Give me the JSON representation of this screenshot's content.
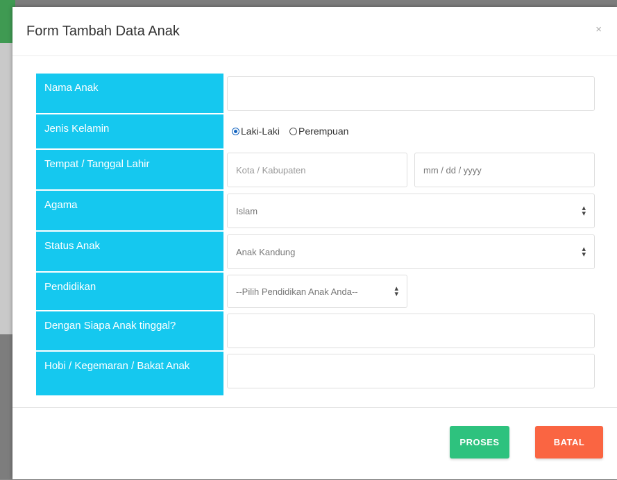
{
  "modal": {
    "title": "Form Tambah Data Anak",
    "close_symbol": "×"
  },
  "form": {
    "nama_anak": {
      "label": "Nama Anak",
      "value": ""
    },
    "jenis_kelamin": {
      "label": "Jenis Kelamin",
      "options": [
        "Laki-Laki",
        "Perempuan"
      ],
      "selected": "Laki-Laki"
    },
    "tempat_tanggal_lahir": {
      "label": "Tempat / Tanggal Lahir",
      "tempat_placeholder": "Kota / Kabupaten",
      "tanggal_placeholder": "mm / dd / yyyy"
    },
    "agama": {
      "label": "Agama",
      "selected": "Islam"
    },
    "status_anak": {
      "label": "Status Anak",
      "selected": "Anak Kandung"
    },
    "pendidikan": {
      "label": "Pendidikan",
      "selected": "--Pilih Pendidikan Anak Anda--"
    },
    "tinggal_dengan": {
      "label": "Dengan Siapa Anak tinggal?",
      "value": ""
    },
    "hobi": {
      "label": "Hobi / Kegemaran / Bakat Anak",
      "value": ""
    }
  },
  "footer": {
    "proses_label": "PROSES",
    "batal_label": "BATAL"
  },
  "colors": {
    "label_bg": "#15c8ef",
    "proses": "#2ec27e",
    "batal": "#fa6542"
  },
  "icons": {
    "close": "close-icon",
    "select_arrow": "select-arrows-icon"
  }
}
